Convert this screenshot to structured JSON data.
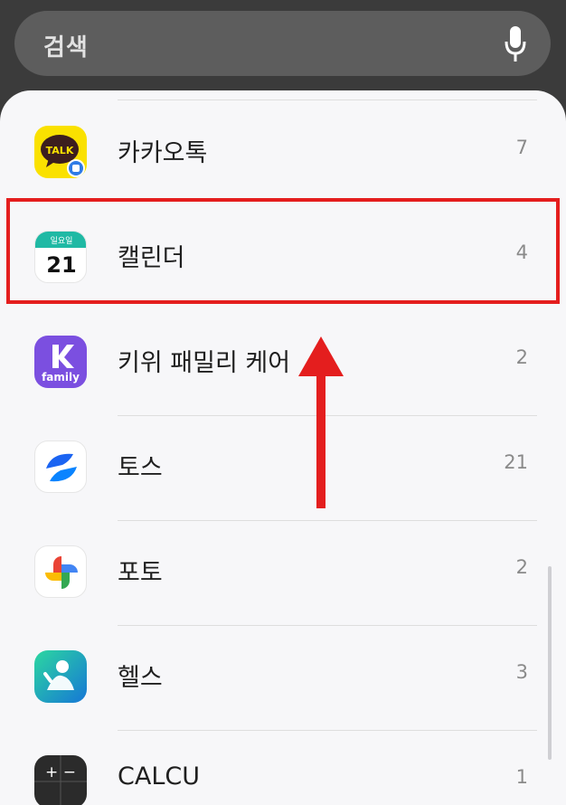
{
  "search": {
    "placeholder": "검색",
    "mic_icon": "microphone-icon"
  },
  "apps": [
    {
      "name": "카카오톡",
      "count": "7",
      "icon": "kakaotalk-icon",
      "icon_text": "TALK"
    },
    {
      "name": "캘린더",
      "count": "4",
      "icon": "calendar-icon",
      "icon_day_label": "일요일",
      "icon_date": "21"
    },
    {
      "name": "키위 패밀리 케어",
      "count": "2",
      "icon": "kiwi-family-icon",
      "icon_text": "family"
    },
    {
      "name": "토스",
      "count": "21",
      "icon": "toss-icon"
    },
    {
      "name": "포토",
      "count": "2",
      "icon": "photos-icon"
    },
    {
      "name": "헬스",
      "count": "3",
      "icon": "health-icon"
    },
    {
      "name": "CALCU",
      "count": "1",
      "icon": "calculator-icon",
      "icon_text": "+ −"
    }
  ],
  "colors": {
    "highlight": "#e41e1e",
    "arrow": "#e41e1e",
    "kakao_yellow": "#fae100"
  }
}
